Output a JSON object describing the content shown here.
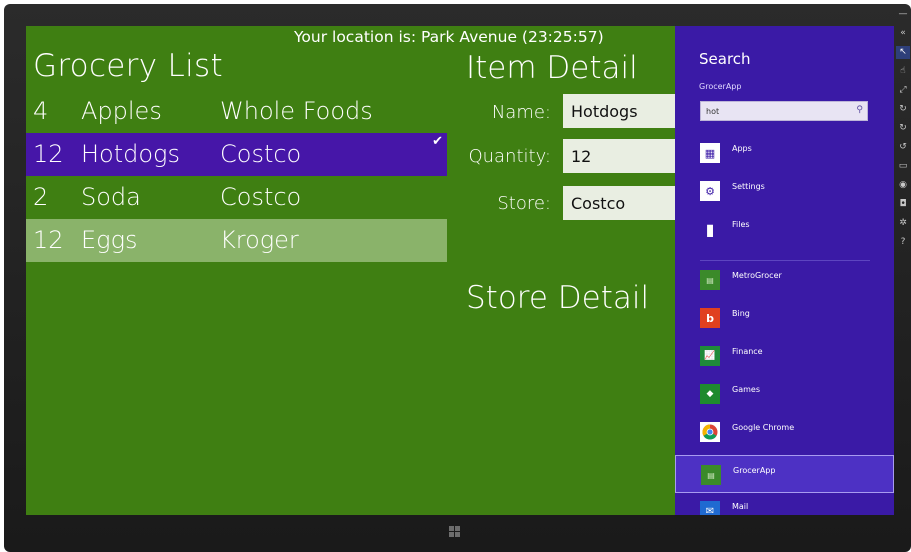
{
  "app": {
    "location": "Your location is: Park Avenue (23:25:57)",
    "list_title": "Grocery List",
    "items": [
      {
        "qty": "4",
        "name": "Apples",
        "store": "Whole Foods"
      },
      {
        "qty": "12",
        "name": "Hotdogs",
        "store": "Costco"
      },
      {
        "qty": "2",
        "name": "Soda",
        "store": "Costco"
      },
      {
        "qty": "12",
        "name": "Eggs",
        "store": "Kroger"
      }
    ],
    "detail_title": "Item Detail",
    "name_label": "Name:",
    "name_value": "Hotdogs",
    "quantity_label": "Quantity:",
    "quantity_value": "12",
    "store_label": "Store:",
    "store_value": "Costco",
    "store_detail_title": "Store Detail"
  },
  "charm": {
    "title": "Search",
    "app_name": "GrocerApp",
    "query": "hot",
    "categories": [
      {
        "label": "Apps",
        "icon": "apps-icon"
      },
      {
        "label": "Settings",
        "icon": "settings-icon"
      },
      {
        "label": "Files",
        "icon": "files-icon"
      }
    ],
    "apps": [
      {
        "label": "MetroGrocer",
        "icon": "metrogrocer-icon",
        "color": "#3b8a2a"
      },
      {
        "label": "Bing",
        "icon": "bing-icon",
        "color": "#e0401f"
      },
      {
        "label": "Finance",
        "icon": "finance-icon",
        "color": "#1f8a3a"
      },
      {
        "label": "Games",
        "icon": "games-icon",
        "color": "#1e8a2e"
      },
      {
        "label": "Google Chrome",
        "icon": "chrome-icon",
        "color": "#ffffff"
      },
      {
        "label": "GrocerApp",
        "icon": "grocerapp-icon",
        "color": "#3b8a2a"
      },
      {
        "label": "Mail",
        "icon": "mail-icon",
        "color": "#1f6ad1"
      }
    ]
  },
  "colors": {
    "app_background": "#3f7f12",
    "selected_row": "#4616a8",
    "hover_row": "#8ab36a",
    "charm_background": "#3a1aa6"
  }
}
